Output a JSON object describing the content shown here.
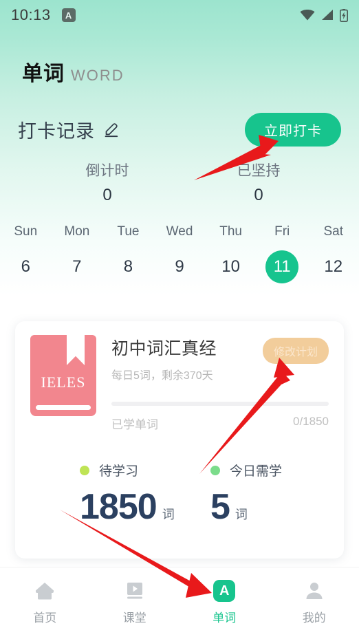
{
  "status_bar": {
    "time": "10:13",
    "app_badge_letter": "A",
    "icons": [
      "wifi-icon",
      "signal-icon",
      "battery-charging-icon"
    ]
  },
  "header": {
    "title_cn": "单词",
    "title_en": "WORD"
  },
  "record": {
    "title": "打卡记录",
    "edit_icon": "pencil-icon",
    "checkin_label": "立即打卡",
    "counters": [
      {
        "label": "倒计时",
        "value": "0"
      },
      {
        "label": "已坚持",
        "value": "0"
      }
    ]
  },
  "week": {
    "days": [
      {
        "dow": "Sun",
        "num": "6",
        "active": false
      },
      {
        "dow": "Mon",
        "num": "7",
        "active": false
      },
      {
        "dow": "Tue",
        "num": "8",
        "active": false
      },
      {
        "dow": "Wed",
        "num": "9",
        "active": false
      },
      {
        "dow": "Thu",
        "num": "10",
        "active": false
      },
      {
        "dow": "Fri",
        "num": "11",
        "active": true
      },
      {
        "dow": "Sat",
        "num": "12",
        "active": false
      }
    ]
  },
  "plan_card": {
    "book_label": "IELES",
    "title": "初中词汇真经",
    "subtitle": "每日5词，剩余370天",
    "edit_plan_label": "修改计划",
    "progress_label": "已学单词",
    "progress_value": "0/1850",
    "progress_percent": 0,
    "stats": [
      {
        "label": "待学习",
        "number": "1850",
        "unit": "词",
        "dot_color": "#bfe455"
      },
      {
        "label": "今日需学",
        "number": "5",
        "unit": "词",
        "dot_color": "#7bdc8b"
      }
    ]
  },
  "bottom_nav": {
    "items": [
      {
        "label": "首页",
        "icon": "home-icon",
        "active": false
      },
      {
        "label": "课堂",
        "icon": "play-icon",
        "active": false
      },
      {
        "label": "单词",
        "icon": "word-a-icon",
        "active": true
      },
      {
        "label": "我的",
        "icon": "person-icon",
        "active": false
      }
    ]
  },
  "colors": {
    "accent_green": "#17c48d",
    "header_gradient_top": "#9ce4ce",
    "book_pink": "#f2868e",
    "edit_plan_tan": "#f2cd9b",
    "stat_navy": "#2b4060",
    "annotation_red": "#e8191b"
  }
}
